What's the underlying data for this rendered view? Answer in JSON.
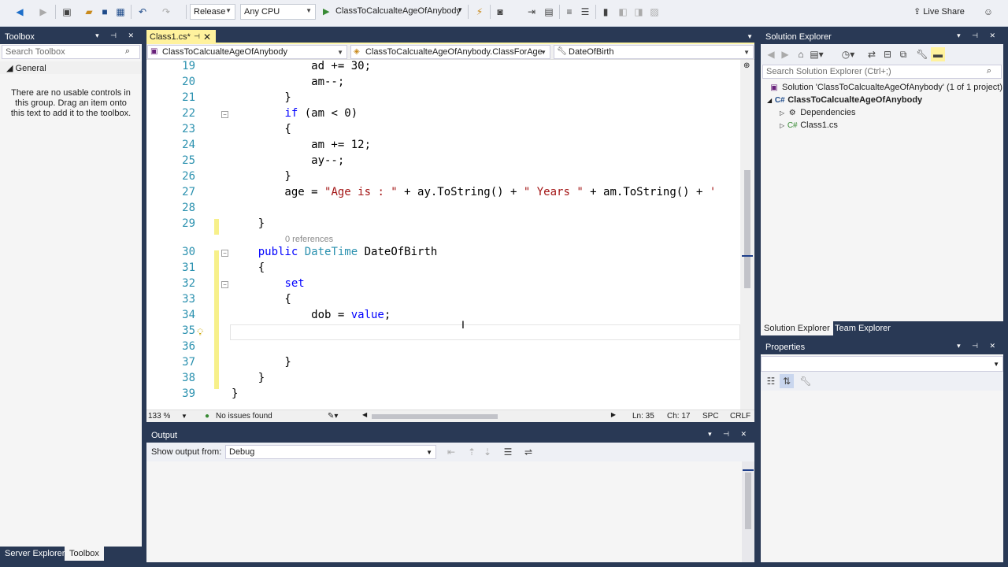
{
  "toolbar": {
    "config": "Release",
    "platform": "Any CPU",
    "start_project": "ClassToCalcualteAgeOfAnybody",
    "live_share": "Live Share"
  },
  "toolbox": {
    "title": "Toolbox",
    "search_placeholder": "Search Toolbox",
    "group": "General",
    "message": "There are no usable controls in this group. Drag an item onto this text to add it to the toolbox."
  },
  "bottom_tabs": [
    "Server Explorer",
    "Toolbox"
  ],
  "editor": {
    "tab_label": "Class1.cs*",
    "nav_project": "ClassToCalcualteAgeOfAnybody",
    "nav_class": "ClassToCalcualteAgeOfAnybody.ClassForAge",
    "nav_member": "DateOfBirth",
    "references": "0 references",
    "lines": [
      {
        "num": "19",
        "tokens": [
          {
            "t": "            ad += 30;",
            "c": ""
          }
        ]
      },
      {
        "num": "20",
        "tokens": [
          {
            "t": "            am--;",
            "c": ""
          }
        ]
      },
      {
        "num": "21",
        "tokens": [
          {
            "t": "        }",
            "c": ""
          }
        ]
      },
      {
        "num": "22",
        "tokens": [
          {
            "t": "        ",
            "c": ""
          },
          {
            "t": "if",
            "c": "kw"
          },
          {
            "t": " (am < 0)",
            "c": ""
          }
        ]
      },
      {
        "num": "23",
        "tokens": [
          {
            "t": "        {",
            "c": ""
          }
        ]
      },
      {
        "num": "24",
        "tokens": [
          {
            "t": "            am += 12;",
            "c": ""
          }
        ]
      },
      {
        "num": "25",
        "tokens": [
          {
            "t": "            ay--;",
            "c": ""
          }
        ]
      },
      {
        "num": "26",
        "tokens": [
          {
            "t": "        }",
            "c": ""
          }
        ]
      },
      {
        "num": "27",
        "tokens": [
          {
            "t": "        age = ",
            "c": ""
          },
          {
            "t": "\"Age is : \"",
            "c": "st"
          },
          {
            "t": " + ay.ToString() + ",
            "c": ""
          },
          {
            "t": "\" Years \"",
            "c": "st"
          },
          {
            "t": " + am.ToString() + ",
            "c": ""
          },
          {
            "t": "'",
            "c": "st"
          }
        ]
      },
      {
        "num": "28",
        "tokens": [
          {
            "t": "",
            "c": ""
          }
        ]
      },
      {
        "num": "29",
        "tokens": [
          {
            "t": "    }",
            "c": ""
          }
        ]
      },
      {
        "num": "30",
        "tokens": [
          {
            "t": "    ",
            "c": ""
          },
          {
            "t": "public",
            "c": "kw"
          },
          {
            "t": " ",
            "c": ""
          },
          {
            "t": "DateTime",
            "c": "ty"
          },
          {
            "t": " DateOfBirth",
            "c": ""
          }
        ]
      },
      {
        "num": "31",
        "tokens": [
          {
            "t": "    {",
            "c": ""
          }
        ]
      },
      {
        "num": "32",
        "tokens": [
          {
            "t": "        ",
            "c": ""
          },
          {
            "t": "set",
            "c": "kw"
          }
        ]
      },
      {
        "num": "33",
        "tokens": [
          {
            "t": "        {",
            "c": ""
          }
        ]
      },
      {
        "num": "34",
        "tokens": [
          {
            "t": "            dob = ",
            "c": ""
          },
          {
            "t": "value",
            "c": "kw"
          },
          {
            "t": ";",
            "c": ""
          }
        ]
      },
      {
        "num": "35",
        "tokens": [
          {
            "t": "",
            "c": ""
          }
        ]
      },
      {
        "num": "36",
        "tokens": [
          {
            "t": "",
            "c": ""
          }
        ]
      },
      {
        "num": "37",
        "tokens": [
          {
            "t": "        }",
            "c": ""
          }
        ]
      },
      {
        "num": "38",
        "tokens": [
          {
            "t": "    }",
            "c": ""
          }
        ]
      },
      {
        "num": "39",
        "tokens": [
          {
            "t": "}",
            "c": ""
          }
        ]
      }
    ],
    "status": {
      "zoom": "133 %",
      "issues": "No issues found",
      "ln": "Ln: 35",
      "ch": "Ch: 17",
      "spc": "SPC",
      "crlf": "CRLF"
    }
  },
  "output": {
    "title": "Output",
    "show_from_label": "Show output from:",
    "source": "Debug"
  },
  "solution_explorer": {
    "title": "Solution Explorer",
    "search_placeholder": "Search Solution Explorer (Ctrl+;)",
    "solution": "Solution 'ClassToCalcualteAgeOfAnybody' (1 of 1 project)",
    "project": "ClassToCalcualteAgeOfAnybody",
    "items": [
      "Dependencies",
      "Class1.cs"
    ],
    "tabs": [
      "Solution Explorer",
      "Team Explorer"
    ]
  },
  "properties": {
    "title": "Properties"
  },
  "colors": {
    "chrome": "#293955",
    "keyword": "#0000ff",
    "type": "#2b91af",
    "string": "#a31515",
    "active_tab": "#fff29d"
  }
}
